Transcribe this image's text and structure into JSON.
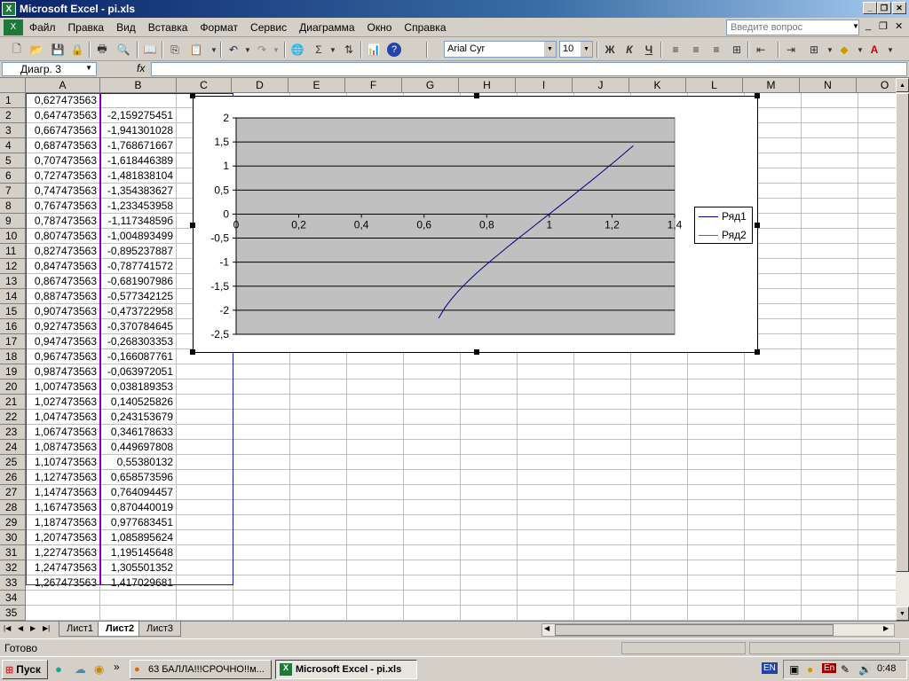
{
  "window": {
    "title": "Microsoft Excel - pi.xls",
    "icon": "excel-icon"
  },
  "menu": {
    "items": [
      "Файл",
      "Правка",
      "Вид",
      "Вставка",
      "Формат",
      "Сервис",
      "Диаграмма",
      "Окно",
      "Справка"
    ],
    "ask_placeholder": "Введите вопрос"
  },
  "toolbar": {
    "font_name": "Arial Cyr",
    "font_size": "10",
    "bold": "Ж",
    "italic": "К",
    "underline": "Ч"
  },
  "formula_bar": {
    "name_box": "Диагр. 3",
    "fx": "fx",
    "value": ""
  },
  "sheet": {
    "columns": [
      "A",
      "B",
      "C",
      "D",
      "E",
      "F",
      "G",
      "H",
      "I",
      "J",
      "K",
      "L",
      "M",
      "N",
      "O"
    ],
    "rows": [
      {
        "n": "1",
        "a": "0,627473563",
        "b": ""
      },
      {
        "n": "2",
        "a": "0,647473563",
        "b": "-2,159275451"
      },
      {
        "n": "3",
        "a": "0,667473563",
        "b": "-1,941301028"
      },
      {
        "n": "4",
        "a": "0,687473563",
        "b": "-1,768671667"
      },
      {
        "n": "5",
        "a": "0,707473563",
        "b": "-1,618446389"
      },
      {
        "n": "6",
        "a": "0,727473563",
        "b": "-1,481838104"
      },
      {
        "n": "7",
        "a": "0,747473563",
        "b": "-1,354383627"
      },
      {
        "n": "8",
        "a": "0,767473563",
        "b": "-1,233453958"
      },
      {
        "n": "9",
        "a": "0,787473563",
        "b": "-1,11734859б"
      },
      {
        "n": "10",
        "a": "0,807473563",
        "b": "-1,004893499"
      },
      {
        "n": "11",
        "a": "0,827473563",
        "b": "-0,895237887"
      },
      {
        "n": "12",
        "a": "0,847473563",
        "b": "-0,787741572"
      },
      {
        "n": "13",
        "a": "0,867473563",
        "b": "-0,681907986"
      },
      {
        "n": "14",
        "a": "0,887473563",
        "b": "-0,577342125"
      },
      {
        "n": "15",
        "a": "0,907473563",
        "b": "-0,473722958"
      },
      {
        "n": "16",
        "a": "0,927473563",
        "b": "-0,370784645"
      },
      {
        "n": "17",
        "a": "0,947473563",
        "b": "-0,268303353"
      },
      {
        "n": "18",
        "a": "0,967473563",
        "b": "-0,166087761"
      },
      {
        "n": "19",
        "a": "0,987473563",
        "b": "-0,063972051"
      },
      {
        "n": "20",
        "a": "1,007473563",
        "b": "0,038189353"
      },
      {
        "n": "21",
        "a": "1,027473563",
        "b": "0,140525826"
      },
      {
        "n": "22",
        "a": "1,047473563",
        "b": "0,243153679"
      },
      {
        "n": "23",
        "a": "1,067473563",
        "b": "0,346178633"
      },
      {
        "n": "24",
        "a": "1,087473563",
        "b": "0,449697808"
      },
      {
        "n": "25",
        "a": "1,107473563",
        "b": "0,55380132"
      },
      {
        "n": "26",
        "a": "1,127473563",
        "b": "0,658573596"
      },
      {
        "n": "27",
        "a": "1,147473563",
        "b": "0,764094457"
      },
      {
        "n": "28",
        "a": "1,167473563",
        "b": "0,870440019"
      },
      {
        "n": "29",
        "a": "1,187473563",
        "b": "0,977683451"
      },
      {
        "n": "30",
        "a": "1,207473563",
        "b": "1,085895624"
      },
      {
        "n": "31",
        "a": "1,227473563",
        "b": "1,195145648"
      },
      {
        "n": "32",
        "a": "1,247473563",
        "b": "1,305501352"
      },
      {
        "n": "33",
        "a": "1,267473563",
        "b": "1,417029681"
      },
      {
        "n": "34",
        "a": "",
        "b": ""
      },
      {
        "n": "35",
        "a": "",
        "b": ""
      }
    ],
    "tabs": [
      "Лист1",
      "Лист2",
      "Лист3"
    ],
    "active_tab": "Лист2"
  },
  "chart_data": {
    "type": "scatter",
    "title": "",
    "xlim": [
      0,
      1.4
    ],
    "ylim": [
      -2.5,
      2
    ],
    "x_ticks": [
      "0",
      "0,2",
      "0,4",
      "0,6",
      "0,8",
      "1",
      "1,2",
      "1,4"
    ],
    "y_ticks": [
      "2",
      "1,5",
      "1",
      "0,5",
      "0",
      "-0,5",
      "-1",
      "-1,5",
      "-2",
      "-2,5"
    ],
    "plot_bg": "#c0c0c0",
    "grid": "horizontal",
    "legend_position": "right",
    "series": [
      {
        "name": "Ряд1",
        "color": "#000080",
        "x": [
          0.647,
          0.667,
          0.687,
          0.707,
          0.727,
          0.747,
          0.767,
          0.787,
          0.807,
          0.827,
          0.847,
          0.867,
          0.887,
          0.907,
          0.927,
          0.947,
          0.967,
          0.987,
          1.007,
          1.027,
          1.047,
          1.067,
          1.087,
          1.107,
          1.127,
          1.147,
          1.167,
          1.187,
          1.207,
          1.227,
          1.247,
          1.267
        ],
        "y": [
          -2.159,
          -1.941,
          -1.769,
          -1.618,
          -1.482,
          -1.354,
          -1.233,
          -1.117,
          -1.005,
          -0.895,
          -0.788,
          -0.682,
          -0.577,
          -0.474,
          -0.371,
          -0.268,
          -0.166,
          -0.064,
          0.038,
          0.141,
          0.243,
          0.346,
          0.45,
          0.554,
          0.659,
          0.764,
          0.87,
          0.978,
          1.086,
          1.195,
          1.306,
          1.417
        ]
      },
      {
        "name": "Ряд2",
        "color": "#ff00ff",
        "x": [],
        "y": []
      }
    ]
  },
  "status": {
    "text": "Готово"
  },
  "taskbar": {
    "start": "Пуск",
    "tasks": [
      "63 БАЛЛА!!!СРОЧНО!!м...",
      "Microsoft Excel - pi.xls"
    ],
    "lang": "EN",
    "lang2": "En",
    "clock": "0:48"
  }
}
